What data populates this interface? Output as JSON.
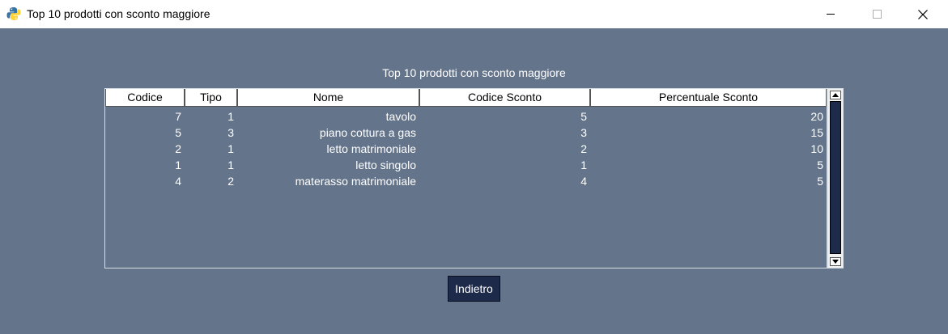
{
  "window": {
    "title": "Top 10 prodotti con sconto maggiore",
    "icon": "python-icon"
  },
  "heading": "Top 10 prodotti con sconto maggiore",
  "table": {
    "columns": [
      "Codice",
      "Tipo",
      "Nome",
      "Codice Sconto",
      "Percentuale Sconto"
    ],
    "rows": [
      [
        "7",
        "1",
        "tavolo",
        "5",
        "20"
      ],
      [
        "5",
        "3",
        "piano cottura a gas",
        "3",
        "15"
      ],
      [
        "2",
        "1",
        "letto matrimoniale",
        "2",
        "10"
      ],
      [
        "1",
        "1",
        "letto singolo",
        "1",
        "5"
      ],
      [
        "4",
        "2",
        "materasso matrimoniale",
        "4",
        "5"
      ]
    ]
  },
  "buttons": {
    "back": "Indietro"
  },
  "colors": {
    "background": "#64748b",
    "button": "#1e2a4a",
    "header": "#ffffff"
  }
}
